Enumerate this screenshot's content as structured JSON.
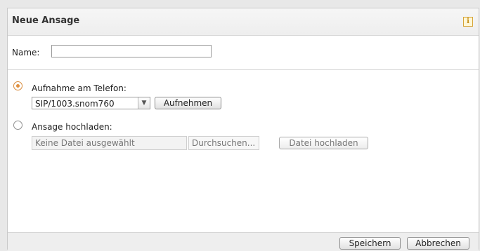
{
  "dialog": {
    "title": "Neue Ansage",
    "info_icon": "i"
  },
  "name": {
    "label": "Name:",
    "value": ""
  },
  "record": {
    "label": "Aufnahme am Telefon:",
    "selected": true,
    "device_value": "SIP/1003.snom760",
    "record_button": "Aufnehmen"
  },
  "upload": {
    "label": "Ansage hochladen:",
    "selected": false,
    "file_value": "Keine Datei ausgewählt",
    "browse_label": "Durchsuchen...",
    "upload_button": "Datei hochladen"
  },
  "footer": {
    "save_label": "Speichern",
    "cancel_label": "Abbrechen"
  },
  "colors": {
    "radio_selected": "#e0903e",
    "info_icon": "#d7a437"
  }
}
